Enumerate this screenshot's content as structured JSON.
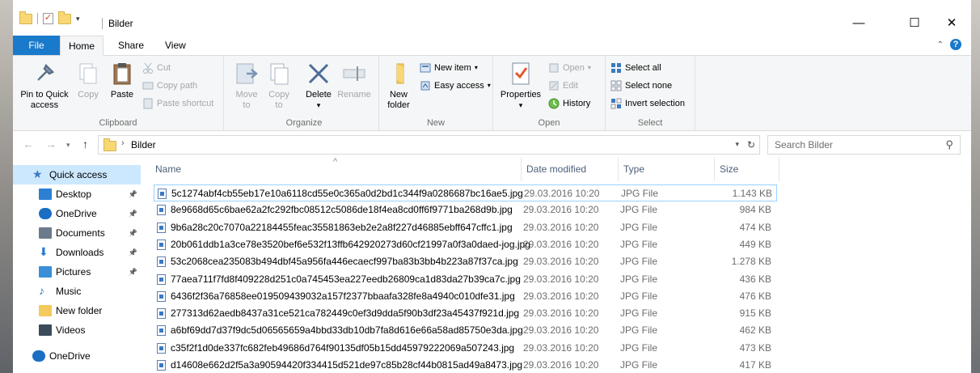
{
  "window": {
    "title": "Bilder",
    "controls": {
      "minimize": "—",
      "maximize": "☐",
      "close": "✕"
    }
  },
  "tabs": {
    "file": "File",
    "home": "Home",
    "share": "Share",
    "view": "View"
  },
  "ribbon": {
    "clipboard": {
      "label": "Clipboard",
      "pin_line1": "Pin to Quick",
      "pin_line2": "access",
      "copy": "Copy",
      "paste": "Paste",
      "cut": "Cut",
      "copy_path": "Copy path",
      "paste_shortcut": "Paste shortcut"
    },
    "organize": {
      "label": "Organize",
      "move_line1": "Move",
      "move_line2": "to",
      "copy_line1": "Copy",
      "copy_line2": "to",
      "delete": "Delete",
      "rename": "Rename"
    },
    "new": {
      "label": "New",
      "new_folder_line1": "New",
      "new_folder_line2": "folder",
      "new_item": "New item",
      "easy_access": "Easy access"
    },
    "open": {
      "label": "Open",
      "properties": "Properties",
      "open": "Open",
      "edit": "Edit",
      "history": "History"
    },
    "select": {
      "label": "Select",
      "select_all": "Select all",
      "select_none": "Select none",
      "invert_selection": "Invert selection"
    }
  },
  "address": {
    "path": "Bilder",
    "search_placeholder": "Search Bilder"
  },
  "nav_pane": {
    "items": [
      {
        "label": "Quick access",
        "icon": "star-icon",
        "pinned": false
      },
      {
        "label": "Desktop",
        "icon": "desktop-icon",
        "pinned": true
      },
      {
        "label": "OneDrive",
        "icon": "cloud-icon",
        "pinned": true
      },
      {
        "label": "Documents",
        "icon": "documents-icon",
        "pinned": true
      },
      {
        "label": "Downloads",
        "icon": "download-icon",
        "pinned": true
      },
      {
        "label": "Pictures",
        "icon": "pictures-icon",
        "pinned": true
      },
      {
        "label": "Music",
        "icon": "music-icon",
        "pinned": false
      },
      {
        "label": "New folder",
        "icon": "folder-icon",
        "pinned": false
      },
      {
        "label": "Videos",
        "icon": "videos-icon",
        "pinned": false
      },
      {
        "label": "OneDrive",
        "icon": "cloud-icon",
        "pinned": false
      }
    ]
  },
  "columns": {
    "name": "Name",
    "date": "Date modified",
    "type": "Type",
    "size": "Size"
  },
  "files": [
    {
      "name": "5c1274abf4cb55eb17e10a6118cd55e0c365a0d2bd1c344f9a0286687bc16ae5.jpg",
      "date": "29.03.2016 10:20",
      "type": "JPG File",
      "size": "1.143 KB"
    },
    {
      "name": "8e9668d65c6bae62a2fc292fbc08512c5086de18f4ea8cd0ff6f9771ba268d9b.jpg",
      "date": "29.03.2016 10:20",
      "type": "JPG File",
      "size": "984 KB"
    },
    {
      "name": "9b6a28c20c7070a22184455feac35581863eb2e2a8f227d46885ebff647cffc1.jpg",
      "date": "29.03.2016 10:20",
      "type": "JPG File",
      "size": "474 KB"
    },
    {
      "name": "20b061ddb1a3ce78e3520bef6e532f13ffb642920273d60cf21997a0f3a0daed-jog.jpg",
      "date": "29.03.2016 10:20",
      "type": "JPG File",
      "size": "449 KB"
    },
    {
      "name": "53c2068cea235083b494dbf45a956fa446ecaecf997ba83b3bb4b223a87f37ca.jpg",
      "date": "29.03.2016 10:20",
      "type": "JPG File",
      "size": "1.278 KB"
    },
    {
      "name": "77aea711f7fd8f409228d251c0a745453ea227eedb26809ca1d83da27b39ca7c.jpg",
      "date": "29.03.2016 10:20",
      "type": "JPG File",
      "size": "436 KB"
    },
    {
      "name": "6436f2f36a76858ee019509439032a157f2377bbaafa328fe8a4940c010dfe31.jpg",
      "date": "29.03.2016 10:20",
      "type": "JPG File",
      "size": "476 KB"
    },
    {
      "name": "277313d62aedb8437a31ce521ca782449c0ef3d9dda5f90b3df23a45437f921d.jpg",
      "date": "29.03.2016 10:20",
      "type": "JPG File",
      "size": "915 KB"
    },
    {
      "name": "a6bf69dd7d37f9dc5d06565659a4bbd33db10db7fa8d616e66a58ad85750e3da.jpg",
      "date": "29.03.2016 10:20",
      "type": "JPG File",
      "size": "462 KB"
    },
    {
      "name": "c35f2f1d0de337fc682feb49686d764f90135df05b15dd45979222069a507243.jpg",
      "date": "29.03.2016 10:20",
      "type": "JPG File",
      "size": "473 KB"
    },
    {
      "name": "d14608e662d2f5a3a90594420f334415d521de97c85b28cf44b0815ad49a8473.jpg",
      "date": "29.03.2016 10:20",
      "type": "JPG File",
      "size": "417 KB"
    }
  ]
}
